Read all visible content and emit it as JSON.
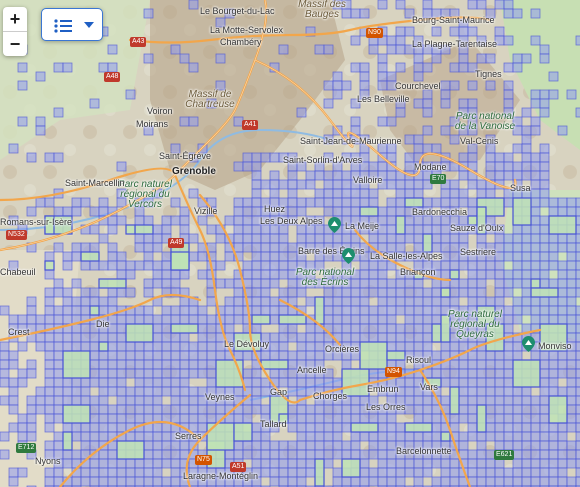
{
  "controls": {
    "zoom_in_label": "+",
    "zoom_out_label": "−"
  },
  "colors": {
    "coverage_fill": "#8f9bf0",
    "coverage_stroke": "#4651d6",
    "road": "#f2a64b",
    "mountain": "#b9a38a",
    "forest": "#bfe3b5"
  },
  "places": {
    "le_bourget": "Le Bourget-du-Lac",
    "la_motte": "La Motte-Servolex",
    "chambery": "Chambéry",
    "bourg_st_maurice": "Bourg-Saint-Maurice",
    "la_plagne": "La Plagne-Tarentaise",
    "tignes": "Tignes",
    "courchevel": "Courchevel",
    "les_belleville": "Les Belleville",
    "voiron": "Voiron",
    "moirans": "Moirans",
    "st_egreve": "Saint-Égrève",
    "grenoble": "Grenoble",
    "st_marcellin": "Saint-Marcellin",
    "vizille": "Vizille",
    "romans": "Romans-sur-Isère",
    "chabeuil": "Chabeuil",
    "crest": "Crest",
    "die": "Die",
    "le_devoluy": "Le Dévoluy",
    "veynes": "Veynes",
    "gap": "Gap",
    "serres": "Serres",
    "laragne": "Laragne-Montéglin",
    "tallard": "Tallard",
    "nyons": "Nyons",
    "st_jean_maurienne": "Saint-Jean-de-Maurienne",
    "st_sorlin": "Saint-Sorlin-d'Arves",
    "valloire": "Valloire",
    "modane": "Modane",
    "val_cenis": "Val-Cenis",
    "susa": "Susa",
    "bardonecchia": "Bardonecchia",
    "sauze": "Sauze d'Oulx",
    "sestriere": "Sestriere",
    "briancon": "Briançon",
    "la_salle": "La Salle-les-Alpes",
    "huez": "Huez",
    "les_deux_alpes": "Les Deux Alpes",
    "la_meije": "La Meije",
    "barre": "Barre des Écrins",
    "orcieres": "Orcières",
    "ancelle": "Ancelle",
    "chorges": "Chorges",
    "embrun": "Embrun",
    "risoul": "Risoul",
    "vars": "Vars",
    "les_orres": "Les Orres",
    "barcelonnette": "Barcelonnette",
    "monviso": "Monviso"
  },
  "regions": {
    "massif_bauges": "Massif des Bauges",
    "massif_chartreuse": "Massif de Chartreuse",
    "parc_vercors": "Parc naturel régional du Vercors",
    "parc_ecrins": "Parc national des Écrins",
    "parc_queyras": "Parc naturel régional du Queyras",
    "parc_vanoise": "Parc national de la Vanoise"
  },
  "roads": {
    "a43": "A43",
    "a48": "A48",
    "a41": "A41",
    "a49": "A49",
    "n90": "N90",
    "n94": "N94",
    "n532": "N532",
    "a51": "A51",
    "n75": "N75",
    "e70": "E70",
    "e712": "E712",
    "e621": "E621"
  }
}
